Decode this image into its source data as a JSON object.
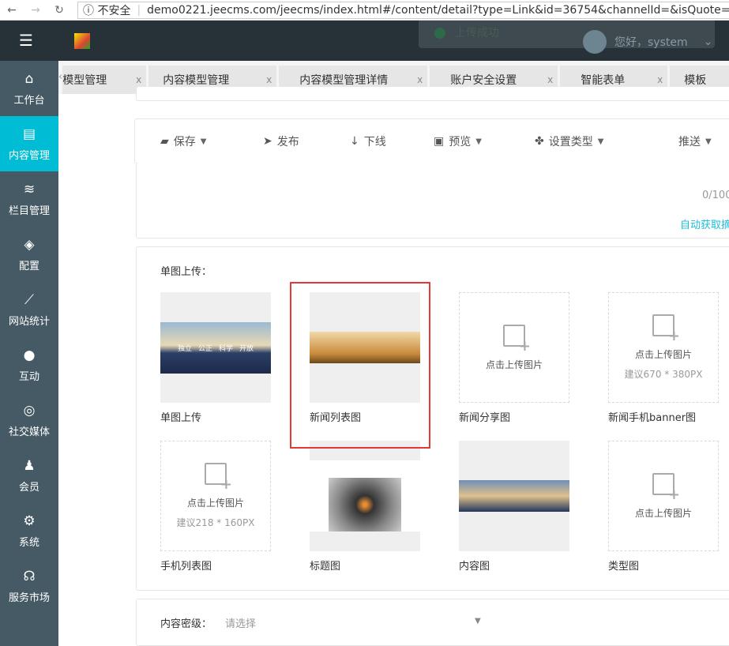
{
  "browser": {
    "security": "不安全",
    "url": "demo0221.jeecms.com/jeecms/index.html#/content/detail?type=Link&id=36754&channelId=&isQuote=false"
  },
  "header": {
    "toast": "上传成功",
    "greeting": "您好，system"
  },
  "sidebar": {
    "items": [
      {
        "label": "工作台",
        "icon": "home-icon"
      },
      {
        "label": "内容管理",
        "icon": "document-icon",
        "active": true
      },
      {
        "label": "栏目管理",
        "icon": "layers-icon"
      },
      {
        "label": "配置",
        "icon": "cube-icon"
      },
      {
        "label": "网站统计",
        "icon": "chart-icon"
      },
      {
        "label": "互动",
        "icon": "chat-icon"
      },
      {
        "label": "社交媒体",
        "icon": "target-icon"
      },
      {
        "label": "会员",
        "icon": "user-icon"
      },
      {
        "label": "系统",
        "icon": "gear-icon"
      },
      {
        "label": "服务市场",
        "icon": "headset-icon"
      }
    ]
  },
  "tabs": [
    {
      "label": "模型管理"
    },
    {
      "label": "内容模型管理"
    },
    {
      "label": "内容模型管理详情"
    },
    {
      "label": "账户安全设置"
    },
    {
      "label": "智能表单"
    },
    {
      "label": "模板"
    }
  ],
  "tab_close": "x",
  "toolbar": {
    "save": "保存",
    "publish": "发布",
    "offline": "下线",
    "preview": "预览",
    "set_type": "设置类型",
    "push": "推送"
  },
  "summary": {
    "counter": "0/100",
    "auto_link": "自动获取摘"
  },
  "upload": {
    "section_label": "单图上传：",
    "upload_text": "点击上传图片",
    "items": [
      {
        "caption": "单图上传",
        "overlay": [
          "独立",
          "公正",
          "科学",
          "开放"
        ]
      },
      {
        "caption": "新闻列表图"
      },
      {
        "caption": "新闻分享图"
      },
      {
        "caption": "新闻手机banner图",
        "hint": "建议670 * 380PX"
      },
      {
        "caption": "手机列表图",
        "hint": "建议218 * 160PX"
      },
      {
        "caption": "标题图"
      },
      {
        "caption": "内容图"
      },
      {
        "caption": "类型图"
      }
    ]
  },
  "secrecy": {
    "label": "内容密级：",
    "placeholder": "请选择"
  }
}
